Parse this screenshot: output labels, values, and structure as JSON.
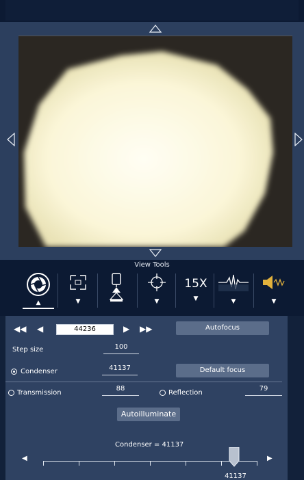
{
  "view_tools": {
    "label": "View Tools",
    "tools": [
      {
        "name": "camera-aperture-icon",
        "has_menu": true,
        "selected": true
      },
      {
        "name": "region-select-icon",
        "has_menu": true
      },
      {
        "name": "condenser-lamp-icon",
        "has_menu": false
      },
      {
        "name": "crosshair-icon",
        "has_menu": true
      },
      {
        "name": "zoom",
        "label": "15X",
        "has_menu": true
      },
      {
        "name": "waveform-icon",
        "has_menu": true
      },
      {
        "name": "speaker-icon",
        "has_menu": true
      }
    ]
  },
  "focus": {
    "position": "44236",
    "autofocus_label": "Autofocus",
    "step_size_label": "Step size",
    "step_size": "100",
    "condenser_label": "Condenser",
    "condenser_value": "41137",
    "default_focus_label": "Default focus",
    "transmission_label": "Transmission",
    "transmission_value": "88",
    "reflection_label": "Reflection",
    "reflection_value": "79",
    "autoilluminate_label": "Autoilluminate",
    "slider_caption": "Condenser = 41137",
    "slider_value": "41137",
    "selected_mode": "Condenser"
  },
  "colors": {
    "accent": "#5b6d8a",
    "panel": "#2f4262",
    "toolbar": "#0c1a33"
  }
}
